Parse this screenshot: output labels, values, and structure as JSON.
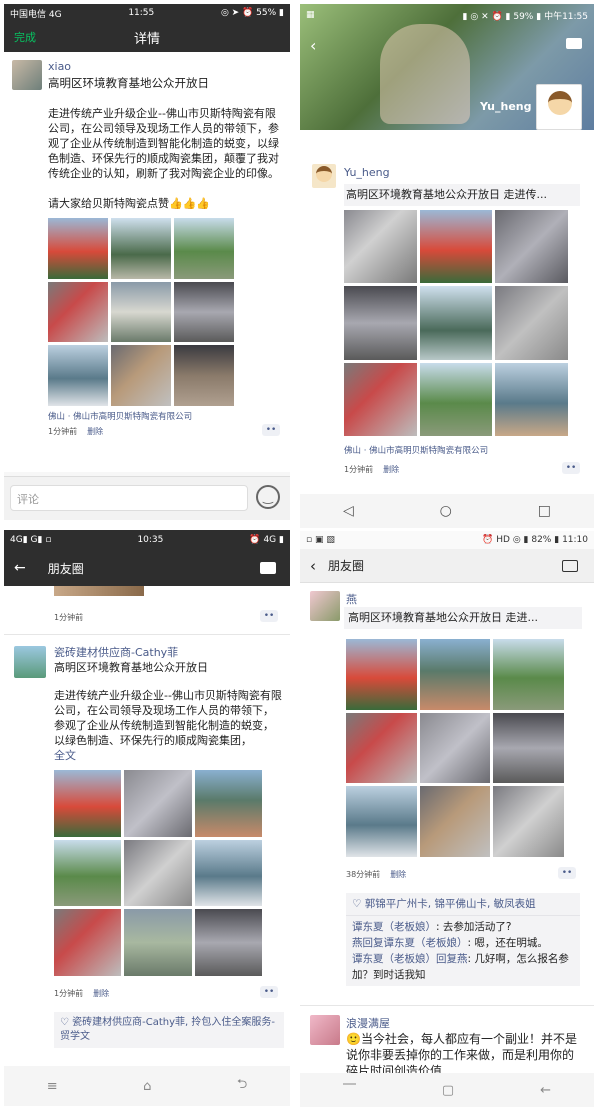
{
  "p1": {
    "status": {
      "carrier": "中国电信",
      "net": "4G",
      "time": "11:55",
      "battery": "55%"
    },
    "nav": {
      "done": "完成",
      "title": "详情"
    },
    "author": "xiao",
    "title": "高明区环境教育基地公众开放日",
    "body": "走进传统产业升级企业--佛山市贝斯特陶瓷有限公司，在公司领导及现场工作人员的带领下，参观了企业从传统制造到智能化制造的蜕变，以绿色制造、环保先行的顺成陶瓷集团，颠覆了我对传统企业的认知，刷新了我对陶瓷企业的印像。",
    "body2": "请大家给贝斯特陶瓷点赞👍👍👍",
    "location": "佛山 · 佛山市高明贝斯特陶瓷有限公司",
    "time": "1分钟前",
    "delete": "删除",
    "comment_placeholder": "评论"
  },
  "p2": {
    "status": {
      "battery": "59%",
      "time": "中午11:55"
    },
    "cover_name": "Yu_heng",
    "author": "Yu_heng",
    "share": "高明区环境教育基地公众开放日 走进传...",
    "location": "佛山 · 佛山市高明贝斯特陶瓷有限公司",
    "time": "1分钟前",
    "delete": "删除"
  },
  "p3": {
    "status": {
      "net": "4G",
      "net2": "G",
      "time": "10:35",
      "net3": "4G"
    },
    "nav": {
      "title": "朋友圈"
    },
    "prev_time": "1分钟前",
    "author": "瓷砖建材供应商-Cathy菲",
    "title": "高明区环境教育基地公众开放日",
    "body": "走进传统产业升级企业--佛山市贝斯特陶瓷有限公司，在公司领导及现场工作人员的带领下，参观了企业从传统制造到智能化制造的蜕变，以绿色制造、环保先行的顺成陶瓷集团，",
    "fulltext": "全文",
    "time": "1分钟前",
    "delete": "删除",
    "likes": "瓷砖建材供应商-Cathy菲, 拎包入住全案服务-贸学文"
  },
  "p4": {
    "status": {
      "battery": "82%",
      "time": "11:10"
    },
    "nav": {
      "title": "朋友圈"
    },
    "author": "燕",
    "share": "高明区环境教育基地公众开放日 走进...",
    "time": "38分钟前",
    "delete": "删除",
    "likes": "郭锦平广州卡, 锦平佛山卡, 敏凤表姐",
    "comments": [
      {
        "who": "谭东夏（老板娘）",
        "sep": ": ",
        "text": "去参加活动了?"
      },
      {
        "who": "燕回复谭东夏（老板娘）",
        "sep": ": ",
        "text": "嗯，还在明城。"
      },
      {
        "who": "谭东夏（老板娘）回复燕",
        "sep": ": ",
        "text": "几好啊，怎么报名参加？到时话我知"
      }
    ],
    "author2": "浪漫满屋",
    "body2": "🙂当今社会，每人都应有一个副业！并不是说你非要丢掉你的工作来做，而是利用你的碎片时间创造价值"
  },
  "colors": {
    "wechat_green": "#07c160",
    "link": "#4a5b8a",
    "topbar": "#2e2e2e"
  }
}
